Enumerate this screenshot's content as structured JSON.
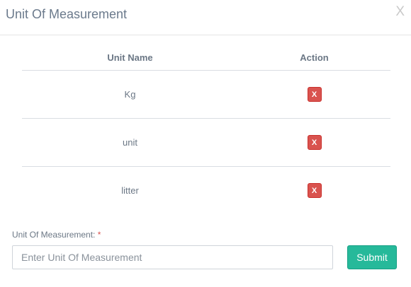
{
  "modal": {
    "title": "Unit Of Measurement",
    "close_label": "X"
  },
  "table": {
    "headers": {
      "name": "Unit Name",
      "action": "Action"
    },
    "rows": [
      {
        "name": "Kg",
        "action_label": "X"
      },
      {
        "name": "unit",
        "action_label": "X"
      },
      {
        "name": "litter",
        "action_label": "X"
      }
    ]
  },
  "form": {
    "label": "Unit Of Measurement:",
    "required_mark": "*",
    "input_value": "",
    "input_placeholder": "Enter Unit Of Measurement",
    "submit_label": "Submit"
  },
  "colors": {
    "danger": "#d9534f",
    "success": "#26b99a"
  }
}
